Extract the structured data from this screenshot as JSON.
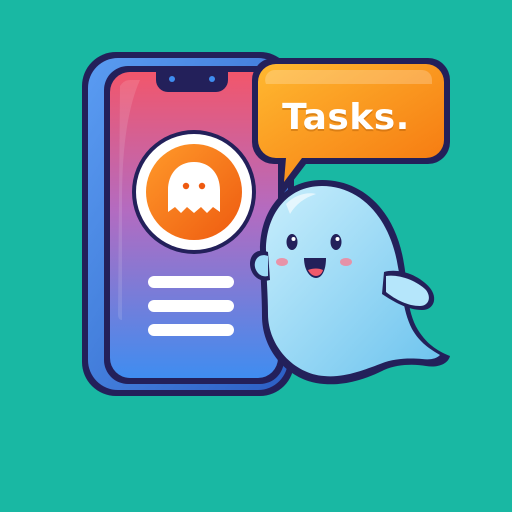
{
  "speech_bubble": {
    "text": "Tasks."
  },
  "icons": {
    "phone": "smartphone-icon",
    "app_badge": "ghost-app-icon",
    "menu": "menu-lines-icon",
    "mascot": "ghost-mascot-icon",
    "bubble": "speech-bubble-icon"
  },
  "colors": {
    "background": "#19b8a3",
    "phone_frame": "#3a7be0",
    "screen_top": "#f2566b",
    "screen_bottom": "#3f8df0",
    "badge_orange": "#f47a14",
    "bubble_orange": "#f8911b",
    "ghost_body": "#9fdcf8",
    "outline": "#23205a"
  }
}
